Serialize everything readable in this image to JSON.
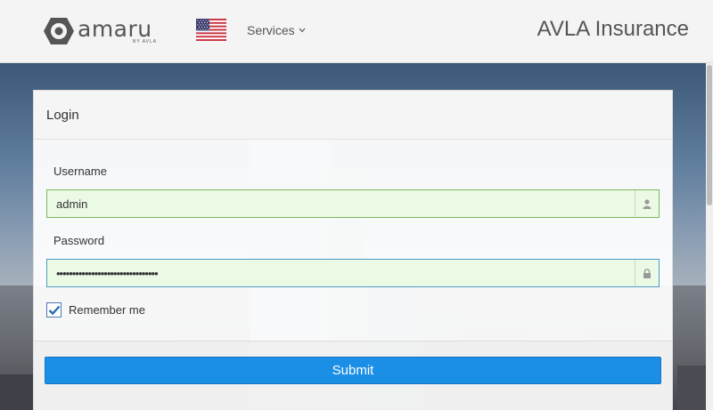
{
  "header": {
    "logo_text": "amaru",
    "logo_sub": "BY AVLA",
    "language_flag": "us-flag-icon",
    "services_label": "Services",
    "company_name": "AVLA Insurance"
  },
  "login": {
    "title": "Login",
    "username_label": "Username",
    "username_value": "admin",
    "password_label": "Password",
    "password_value": "••••••••••••••••••••••••••••••••",
    "remember_label": "Remember me",
    "remember_checked": true,
    "submit_label": "Submit"
  },
  "colors": {
    "accent": "#1b8ee5",
    "field_valid_bg": "#ebfae5",
    "field_valid_border": "#7ab85e"
  }
}
